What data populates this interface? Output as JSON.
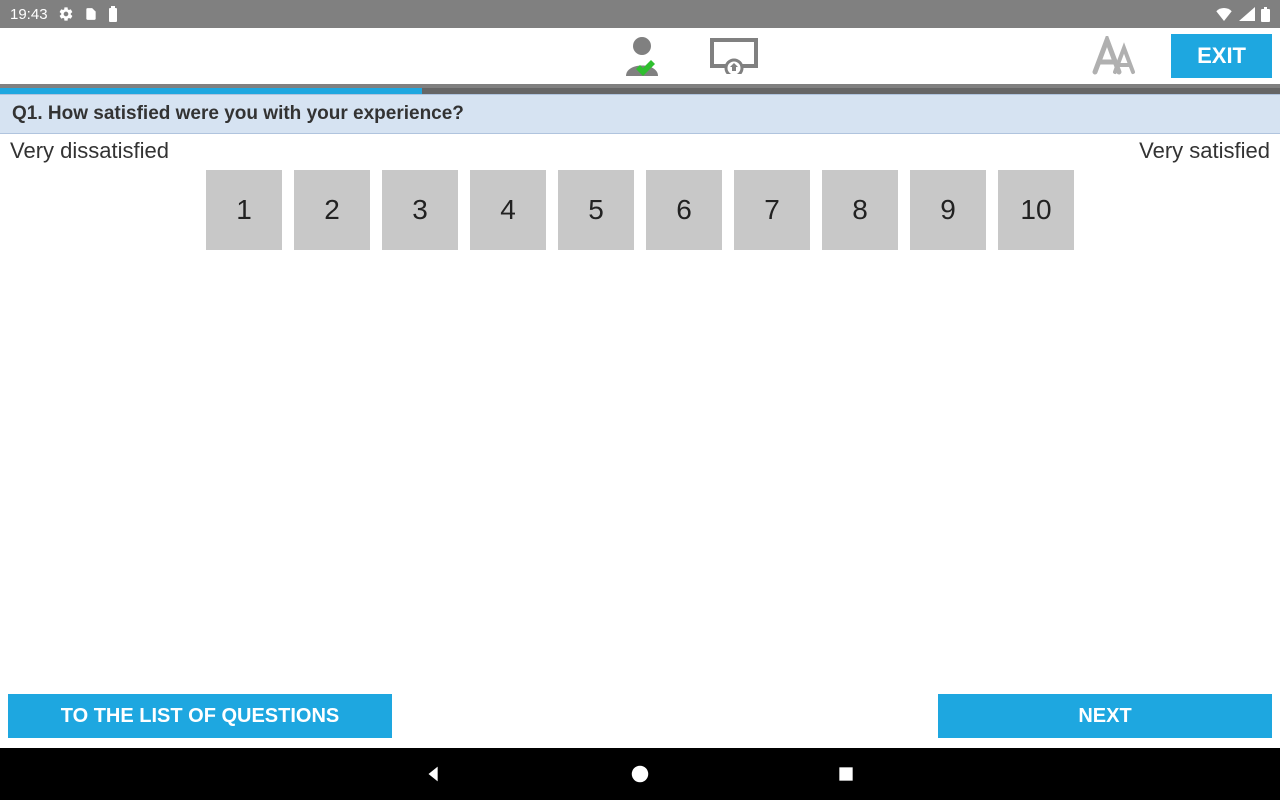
{
  "status": {
    "time": "19:43"
  },
  "header": {
    "exit_label": "EXIT"
  },
  "progress": {
    "percent": 33
  },
  "question": {
    "text": "Q1. How satisfied were you with your experience?",
    "left_label": "Very dissatisfied",
    "right_label": "Very satisfied",
    "options": [
      "1",
      "2",
      "3",
      "4",
      "5",
      "6",
      "7",
      "8",
      "9",
      "10"
    ]
  },
  "footer": {
    "list_label": "TO THE LIST OF QUESTIONS",
    "next_label": "NEXT"
  }
}
